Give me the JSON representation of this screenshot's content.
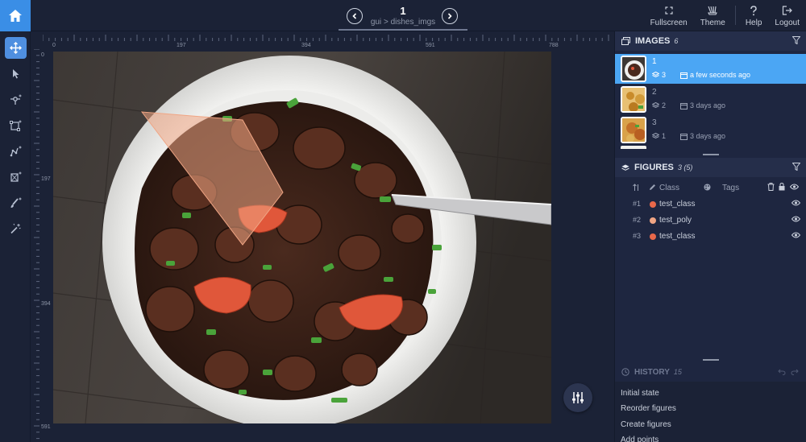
{
  "topbar": {
    "image_number": "1",
    "path_project": "gui",
    "path_separator": ">",
    "path_dataset": "dishes_imgs",
    "buttons": [
      {
        "label": "Fullscreen",
        "icon": "fullscreen-icon"
      },
      {
        "label": "Theme",
        "icon": "theme-icon"
      },
      {
        "label": "Help",
        "icon": "help-icon"
      },
      {
        "label": "Logout",
        "icon": "logout-icon"
      }
    ]
  },
  "toolbar": {
    "tools": [
      "move-icon",
      "pointer-icon",
      "point-tool-icon",
      "rectangle-tool-icon",
      "polyline-tool-icon",
      "polygon-tool-icon",
      "brush-tool-icon",
      "magic-wand-icon"
    ]
  },
  "rulers": {
    "top": [
      "0",
      "197",
      "394",
      "591",
      "788"
    ],
    "left": [
      "0",
      "197",
      "394",
      "591"
    ]
  },
  "images": {
    "title": "IMAGES",
    "count": "6",
    "items": [
      {
        "name": "1",
        "figures": "3",
        "time": "a few seconds ago",
        "selected": true
      },
      {
        "name": "2",
        "figures": "2",
        "time": "3 days ago",
        "selected": false
      },
      {
        "name": "3",
        "figures": "1",
        "time": "3 days ago",
        "selected": false
      }
    ]
  },
  "figures": {
    "title": "FIGURES",
    "count": "3 (5)",
    "col_class": "Class",
    "col_tags": "Tags",
    "items": [
      {
        "num": "1",
        "class": "test_class",
        "color": "#e8684a"
      },
      {
        "num": "2",
        "class": "test_poly",
        "color": "#f0a584"
      },
      {
        "num": "3",
        "class": "test_class",
        "color": "#e8684a"
      }
    ]
  },
  "history": {
    "title": "HISTORY",
    "count": "15",
    "items": [
      "Initial state",
      "Reorder figures",
      "Create figures",
      "Add points"
    ]
  },
  "colors": {
    "accent": "#3a8ee6",
    "selected_row": "#4ba6f4",
    "background": "#1b2236",
    "annotation": "#e8684a"
  }
}
